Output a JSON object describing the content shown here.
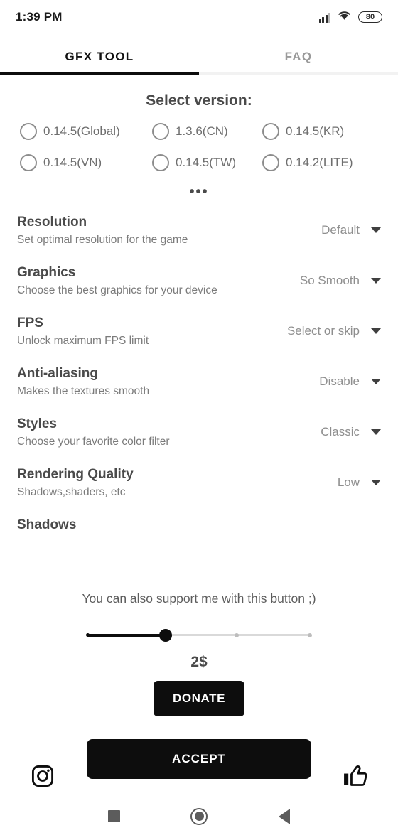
{
  "status_bar": {
    "time": "1:39 PM",
    "battery_level": "80",
    "signal_icon": "signal-bars-icon",
    "wifi_icon": "wifi-icon"
  },
  "tabs": [
    {
      "label": "GFX TOOL",
      "active": true
    },
    {
      "label": "FAQ",
      "active": false
    }
  ],
  "version_section": {
    "title": "Select version:",
    "more_label": "•••",
    "options": [
      {
        "label": "0.14.5(Global)",
        "selected": false
      },
      {
        "label": "1.3.6(CN)",
        "selected": false
      },
      {
        "label": "0.14.5(KR)",
        "selected": false
      },
      {
        "label": "0.14.5(VN)",
        "selected": false
      },
      {
        "label": "0.14.5(TW)",
        "selected": false
      },
      {
        "label": "0.14.2(LITE)",
        "selected": false
      }
    ]
  },
  "settings": [
    {
      "title": "Resolution",
      "subtitle": "Set optimal resolution for the game",
      "value": "Default"
    },
    {
      "title": "Graphics",
      "subtitle": "Choose the best graphics for your device",
      "value": "So Smooth"
    },
    {
      "title": "FPS",
      "subtitle": "Unlock maximum FPS limit",
      "value": "Select or skip"
    },
    {
      "title": "Anti-aliasing",
      "subtitle": "Makes the textures smooth",
      "value": "Disable"
    },
    {
      "title": "Styles",
      "subtitle": "Choose your favorite color filter",
      "value": "Classic"
    },
    {
      "title": "Rendering Quality",
      "subtitle": "Shadows,shaders, etc",
      "value": "Low"
    },
    {
      "title": "Shadows",
      "subtitle": "",
      "value": ""
    }
  ],
  "donate": {
    "message": "You can also support me with this button ;)",
    "amount": "2$",
    "button_label": "DONATE",
    "slider_percent": 35
  },
  "action_bar": {
    "instagram_icon": "instagram-icon",
    "accept_label": "ACCEPT",
    "thumbs_up_icon": "thumbs-up-icon"
  },
  "nav_bar": {
    "recent_icon": "square-recents-icon",
    "home_icon": "circle-home-icon",
    "back_icon": "triangle-back-icon"
  },
  "colors": {
    "accent": "#0d0d0d",
    "title_text": "#4a4a4a",
    "sub_text": "#7b7b7b",
    "value_text": "#8e8e8e"
  }
}
